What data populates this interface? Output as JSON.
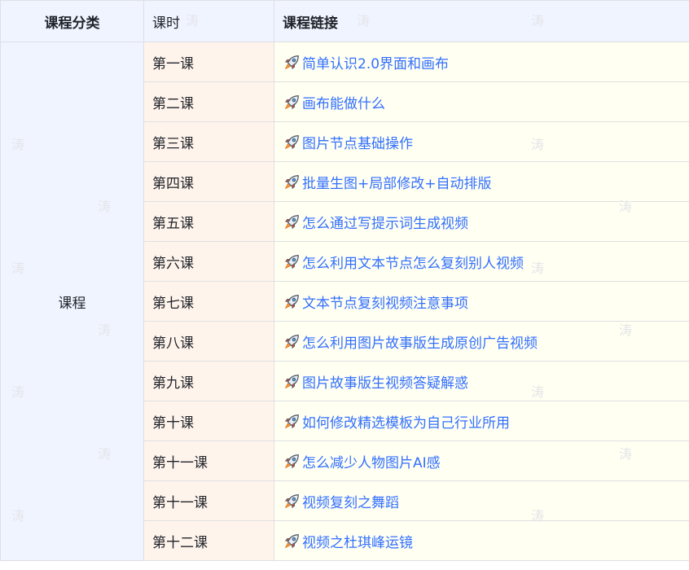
{
  "table": {
    "headers": {
      "category": "课程分类",
      "hours": "课时",
      "link": "课程链接"
    },
    "category": "课程",
    "rows": [
      {
        "lesson": "第一课",
        "title": "简单认识2.0界面和画布"
      },
      {
        "lesson": "第二课",
        "title": "画布能做什么"
      },
      {
        "lesson": "第三课",
        "title": "图片节点基础操作"
      },
      {
        "lesson": "第四课",
        "title": "批量生图+局部修改+自动排版"
      },
      {
        "lesson": "第五课",
        "title": "怎么通过写提示词生成视频"
      },
      {
        "lesson": "第六课",
        "title": "怎么利用文本节点怎么复刻别人视频"
      },
      {
        "lesson": "第七课",
        "title": "文本节点复刻视频注意事项"
      },
      {
        "lesson": "第八课",
        "title": "怎么利用图片故事版生成原创广告视频"
      },
      {
        "lesson": "第九课",
        "title": "图片故事版生视频答疑解惑"
      },
      {
        "lesson": "第十课",
        "title": "如何修改精选模板为自己行业所用"
      },
      {
        "lesson": "第十一课",
        "title": "怎么减少人物图片AI感"
      },
      {
        "lesson": "第十一课",
        "title": "视频复刻之舞蹈"
      },
      {
        "lesson": "第十二课",
        "title": "视频之杜琪峰运镜"
      }
    ]
  },
  "watermark": "涛",
  "icons": {
    "link_icon": "rocket-icon"
  },
  "colors": {
    "link": "#3370ff",
    "header_bg": "#f0f4ff",
    "lesson_bg": "#fff4ec",
    "link_bg": "#fffff2",
    "border": "#dee0e3"
  }
}
